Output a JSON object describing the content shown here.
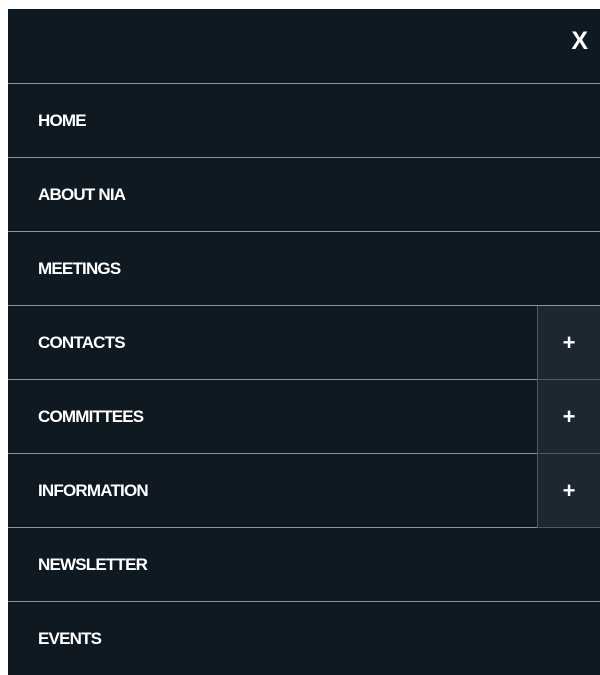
{
  "header": {
    "close_label": "X"
  },
  "menu": {
    "items": [
      {
        "label": "HOME",
        "expandable": false
      },
      {
        "label": "ABOUT NIA",
        "expandable": false
      },
      {
        "label": "MEETINGS",
        "expandable": false
      },
      {
        "label": "CONTACTS",
        "expandable": true,
        "expand_label": "+"
      },
      {
        "label": "COMMITTEES",
        "expandable": true,
        "expand_label": "+"
      },
      {
        "label": "INFORMATION",
        "expandable": true,
        "expand_label": "+"
      },
      {
        "label": "NEWSLETTER",
        "expandable": false
      },
      {
        "label": "EVENTS",
        "expandable": false
      }
    ]
  },
  "colors": {
    "background": "#0f1922",
    "divider": "#8e969c",
    "expand_bg": "#1c2731",
    "text": "#ffffff"
  }
}
